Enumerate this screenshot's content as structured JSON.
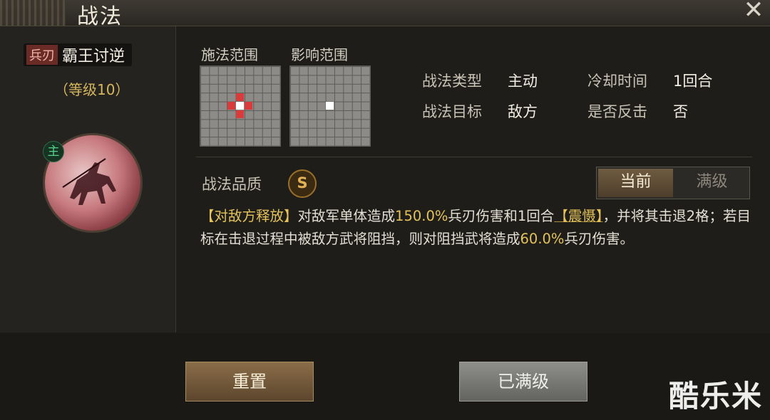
{
  "window": {
    "title": "战法",
    "close_glyph": "✕"
  },
  "skill": {
    "weapon_tag": "兵刃",
    "name": "霸王讨逆",
    "level": "（等级10）",
    "role_badge": "主"
  },
  "ranges": {
    "cast_label": "施法范围",
    "effect_label": "影响范围"
  },
  "info": {
    "type_label": "战法类型",
    "type_value": "主动",
    "cooldown_label": "冷却时间",
    "cooldown_value": "1回合",
    "target_label": "战法目标",
    "target_value": "敌方",
    "counter_label": "是否反击",
    "counter_value": "否"
  },
  "quality": {
    "label": "战法品质",
    "grade": "S"
  },
  "tabs": {
    "current": "当前",
    "max": "满级"
  },
  "description": {
    "p1": "【对敌方释放】",
    "p2": "对敌军单体造成",
    "p3": "150.0%",
    "p4": "兵刃伤害和1回合",
    "p5": "【震慑】",
    "p6": "，并将其击退2格；若目标在击退过程中被敌方武将阻挡，则对阻挡武将造成",
    "p7": "60.0%",
    "p8": "兵刃伤害。"
  },
  "buttons": {
    "reset": "重置",
    "maxed": "已满级"
  },
  "watermark": "酷乐米",
  "colors": {
    "highlight": "#e4c35a",
    "grid_red": "#d93b3b",
    "role_green": "#57d08b",
    "quality_gold": "#e2b155"
  }
}
